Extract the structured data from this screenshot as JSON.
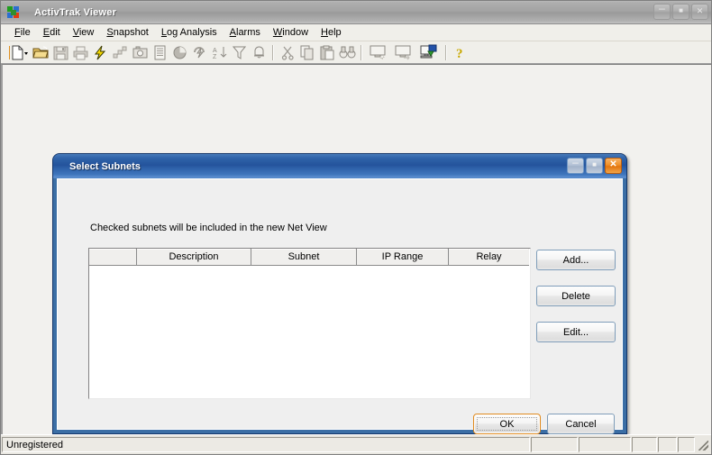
{
  "app": {
    "title": "ActivTrak Viewer",
    "icon": "activtrak-logo-icon",
    "window_buttons": {
      "minimize": "–",
      "maximize": "■",
      "close": "✕"
    }
  },
  "menu": {
    "items": [
      {
        "label": "File",
        "accel": "F"
      },
      {
        "label": "Edit",
        "accel": "E"
      },
      {
        "label": "View",
        "accel": "V"
      },
      {
        "label": "Snapshot",
        "accel": "S"
      },
      {
        "label": "Log Analysis",
        "accel": "L"
      },
      {
        "label": "Alarms",
        "accel": "A"
      },
      {
        "label": "Window",
        "accel": "W"
      },
      {
        "label": "Help",
        "accel": "H"
      }
    ]
  },
  "toolbar": {
    "buttons": [
      {
        "name": "new-icon",
        "enabled": true
      },
      {
        "name": "open-folder-icon",
        "enabled": true
      },
      {
        "name": "save-disk-icon",
        "enabled": false
      },
      {
        "name": "print-icon",
        "enabled": false
      },
      {
        "name": "lightning-icon",
        "enabled": true
      },
      {
        "name": "network-nodes-icon",
        "enabled": false
      },
      {
        "name": "camera-snapshot-icon",
        "enabled": false
      },
      {
        "name": "report-list-icon",
        "enabled": false
      },
      {
        "name": "pie-chart-icon",
        "enabled": false
      },
      {
        "name": "refresh-bolt-icon",
        "enabled": false
      },
      {
        "name": "sort-az-icon",
        "enabled": false
      },
      {
        "name": "filter-funnel-icon",
        "enabled": false
      },
      {
        "name": "alarm-bell-icon",
        "enabled": false
      },
      {
        "name": "cut-scissors-icon",
        "enabled": false
      },
      {
        "name": "copy-icon",
        "enabled": false
      },
      {
        "name": "paste-icon",
        "enabled": false
      },
      {
        "name": "find-binoculars-icon",
        "enabled": false
      },
      {
        "name": "monitor-out-icon",
        "enabled": false
      },
      {
        "name": "monitor-in-icon",
        "enabled": false
      },
      {
        "name": "net-view-icon",
        "enabled": true
      },
      {
        "name": "help-question-icon",
        "enabled": true
      }
    ]
  },
  "dialog": {
    "title": "Select Subnets",
    "hint": "Checked subnets will be included in the new Net View",
    "window_buttons": {
      "minimize": "–",
      "maximize": "■",
      "close": "✕"
    },
    "list": {
      "columns": [
        "",
        "Description",
        "Subnet",
        "IP Range",
        "Relay"
      ],
      "rows": []
    },
    "side_buttons": {
      "add": "Add...",
      "delete": "Delete",
      "edit": "Edit..."
    },
    "footer_buttons": {
      "ok": "OK",
      "cancel": "Cancel"
    }
  },
  "statusbar": {
    "message": "Unregistered",
    "panels": [
      "",
      "",
      "",
      "",
      ""
    ]
  },
  "colors": {
    "dialog_frame_blue": "#3b6ea5",
    "default_button_orange": "#e08a1e",
    "close_button_orange": "#e3760f",
    "client_area": "#f2f1ee"
  }
}
